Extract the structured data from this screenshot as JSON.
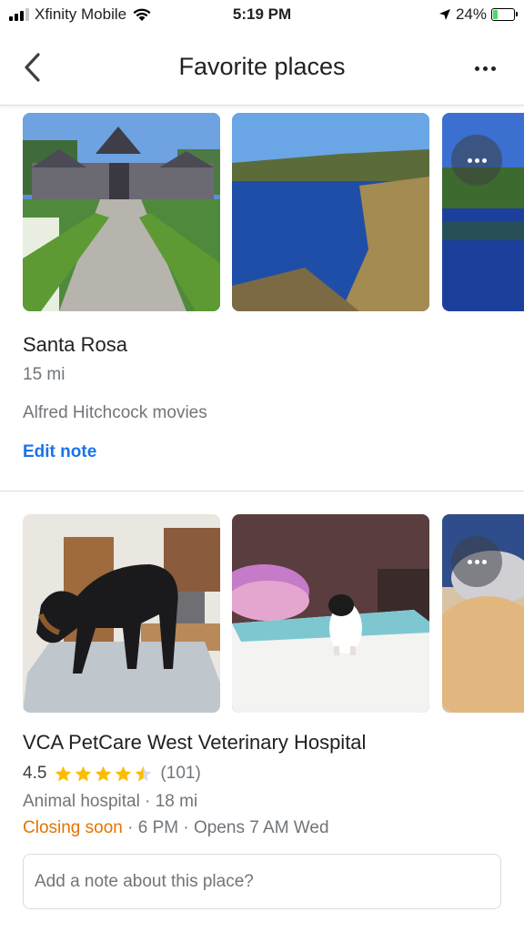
{
  "status_bar": {
    "carrier": "Xfinity Mobile",
    "time": "5:19 PM",
    "battery": "24%"
  },
  "header": {
    "title": "Favorite places",
    "back_icon": "chevron-left-icon",
    "more_icon": "more-horizontal-icon"
  },
  "places": [
    {
      "name": "Santa Rosa",
      "distance": "15 mi",
      "note": "Alfred Hitchcock movies",
      "edit_note_label": "Edit note",
      "photos": [
        "castle-garden-photo",
        "lake-photo",
        "lake-photo-2"
      ]
    },
    {
      "name": "VCA PetCare West Veterinary Hospital",
      "rating": "4.5",
      "rating_value": 4.5,
      "review_count": "(101)",
      "category_distance": "Animal hospital · 18 mi",
      "closing_label": "Closing soon",
      "hours_rest": " · 6 PM · Opens 7 AM Wed",
      "note_placeholder": "Add a note about this place?",
      "photos": [
        "dog-exam-photo",
        "puppy-photo",
        "dog-closeup-photo"
      ]
    }
  ],
  "colors": {
    "accent_blue": "#1a73e8",
    "star_yellow": "#fbbc04",
    "closing_orange": "#e37400",
    "secondary_text": "#70757a"
  }
}
